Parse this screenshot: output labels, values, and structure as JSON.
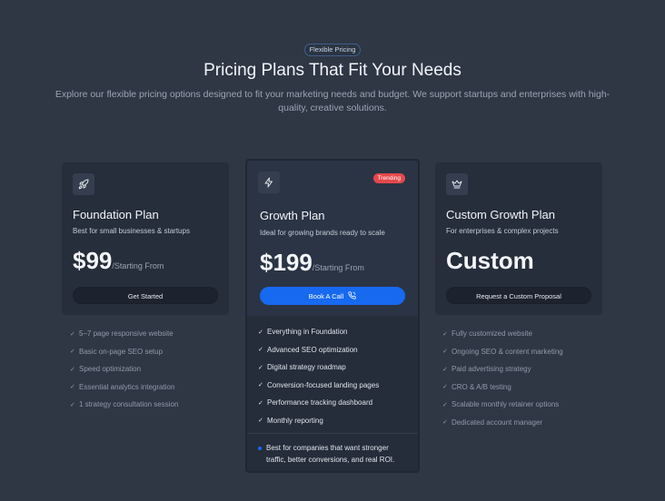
{
  "header": {
    "badge": "Flexible Pricing",
    "title": "Pricing Plans That Fit Your Needs",
    "subtitle": "Explore our flexible pricing options designed to fit your marketing needs and budget. We support startups and enterprises with high-quality, creative solutions."
  },
  "plans": [
    {
      "icon": "rocket-icon",
      "name": "Foundation Plan",
      "description": "Best for small businesses & startups",
      "price": "$99",
      "price_suffix": "/Starting From",
      "button": "Get Started",
      "features": [
        "5–7 page responsive website",
        "Basic on-page SEO setup",
        "Speed optimization",
        "Essential analytics integration",
        "1 strategy consultation session"
      ]
    },
    {
      "icon": "lightning-icon",
      "badge": "Trending",
      "name": "Growth Plan",
      "description": "Ideal for growing brands ready to scale",
      "price": "$199",
      "price_suffix": "/Starting From",
      "button": "Book A Call",
      "features": [
        "Everything in Foundation",
        "Advanced SEO optimization",
        "Digital strategy roadmap",
        "Conversion-focused landing pages",
        "Performance tracking dashboard",
        "Monthly reporting"
      ],
      "note": "Best for companies that want stronger traffic, better conversions, and real ROI."
    },
    {
      "icon": "crown-icon",
      "name": "Custom Growth Plan",
      "description": "For enterprises & complex projects",
      "price": "Custom",
      "button": "Request a Custom Proposal",
      "features": [
        "Fully customized website",
        "Ongoing SEO & content marketing",
        "Paid advertising strategy",
        "CRO & A/B testing",
        "Scalable monthly retainer options",
        "Dedicated account manager"
      ]
    }
  ],
  "colors": {
    "background": "#2f3745",
    "card": "#262e3b",
    "accent": "#1769f0",
    "trending": "#e5484d"
  }
}
